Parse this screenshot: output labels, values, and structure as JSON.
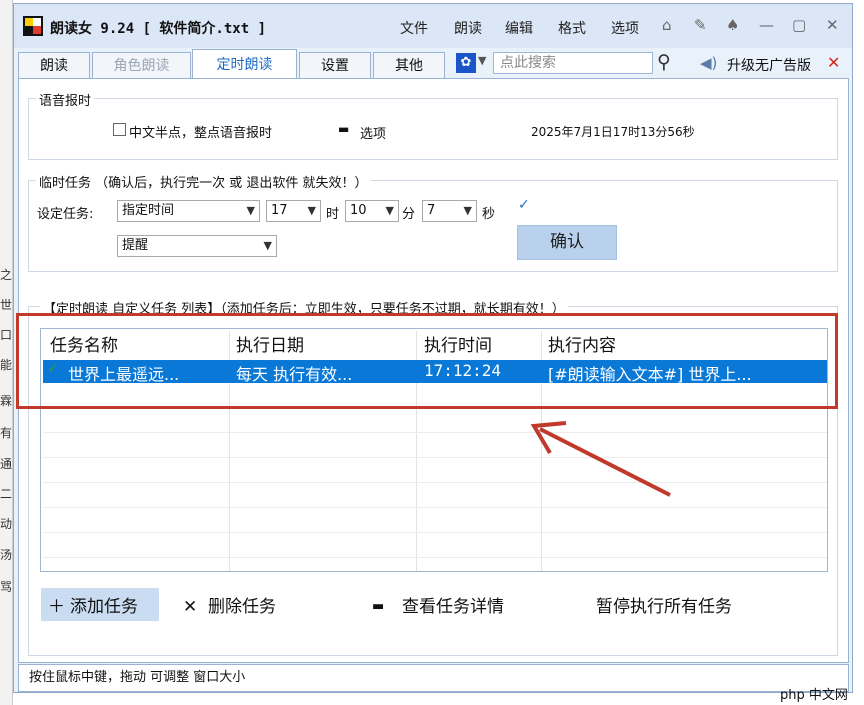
{
  "app": {
    "title": "朗读女 9.24 [ 软件简介.txt ]",
    "menu": [
      "文件",
      "朗读",
      "编辑",
      "格式",
      "选项"
    ],
    "window_controls": [
      "home-icon",
      "pin-icon",
      "shirt-icon",
      "minimize-icon",
      "maximize-icon",
      "close-icon"
    ]
  },
  "tabs": [
    {
      "label": "朗读",
      "state": "normal"
    },
    {
      "label": "角色朗读",
      "state": "disabled"
    },
    {
      "label": "定时朗读",
      "state": "active"
    },
    {
      "label": "设置",
      "state": "normal"
    },
    {
      "label": "其他",
      "state": "normal"
    }
  ],
  "search": {
    "placeholder": "点此搜索"
  },
  "upgrade": {
    "label": "升级无广告版"
  },
  "voice_time": {
    "title": "语音报时",
    "checkbox_label": "中文半点，整点语音报时",
    "options_label": "选项",
    "datetime": "2025年7月1日17时13分56秒"
  },
  "temp_task": {
    "title": "临时任务  （确认后，执行完一次 或 退出软件 就失效！）",
    "set_label": "设定任务:",
    "type_value": "指定时间",
    "hour_value": "17",
    "hour_unit": "时",
    "minute_value": "10",
    "minute_unit": "分",
    "second_value": "7",
    "second_unit": "秒",
    "action_value": "提醒",
    "confirm_label": "确认"
  },
  "custom_tasks": {
    "title": "【定时朗读  自定义任务  列表】（添加任务后：立即生效，只要任务不过期，就长期有效！）",
    "columns": [
      "任务名称",
      "执行日期",
      "执行时间",
      "执行内容"
    ],
    "rows": [
      {
        "name": "世界上最遥远...",
        "date": "每天  执行有效...",
        "time": "17:12:24",
        "content": "[#朗读输入文本#] 世界上..."
      }
    ]
  },
  "actions": {
    "add": "添加任务",
    "delete": "删除任务",
    "details": "查看任务详情",
    "pause_all": "暂停执行所有任务"
  },
  "status": {
    "text": "按住鼠标中键，拖动 可调整 窗口大小"
  },
  "watermark": {
    "text": "php 中文网"
  },
  "left_chars": [
    "之",
    "世",
    "口",
    "能",
    "霖",
    "有",
    "通",
    "二",
    "动",
    "汤",
    "骂"
  ],
  "colors": {
    "selection": "#0a78d7",
    "highlight_box": "#c0392b",
    "accent": "#1f6cc7"
  }
}
